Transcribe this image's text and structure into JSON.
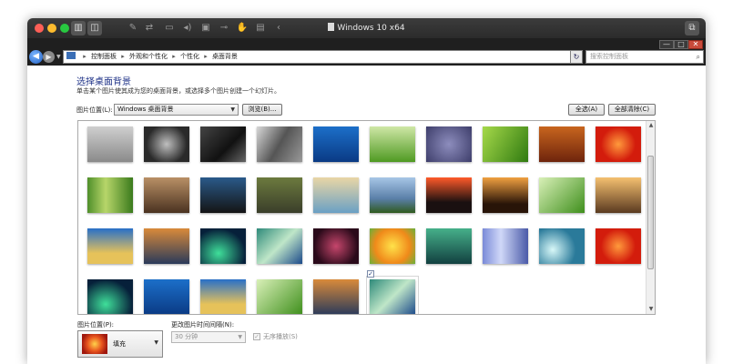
{
  "vm": {
    "title": "Windows 10 x64",
    "toolbar_icons": [
      "wrench-icon",
      "arrows-icon",
      "display-icon",
      "speaker-icon",
      "camera-icon",
      "usb-icon",
      "hand-icon",
      "shared-folder-icon",
      "chevron-left-icon"
    ]
  },
  "window": {
    "ctrl_min": "—",
    "ctrl_max": "□",
    "ctrl_close": "✕"
  },
  "address": {
    "breadcrumb": [
      "控制面板",
      "外观和个性化",
      "个性化",
      "桌面背景"
    ],
    "search_placeholder": "搜索控制面板"
  },
  "page": {
    "heading": "选择桌面背景",
    "subtext": "单击某个图片使其成为您的桌面背景，或选择多个图片创建一个幻灯片。",
    "location_label": "图片位置(L):",
    "location_value": "Windows 桌面背景",
    "browse_label": "浏览(B)...",
    "select_all_label": "全选(A)",
    "clear_all_label": "全部清除(C)"
  },
  "thumbnails": [
    {
      "bg": "linear-gradient(#cfcfcf,#8a8a8a)"
    },
    {
      "bg": "radial-gradient(circle at 50% 50%,#bfbfbf,#2a2a2a 70%)"
    },
    {
      "bg": "linear-gradient(135deg,#444,#111 60%,#666)"
    },
    {
      "bg": "linear-gradient(120deg,#d8d8d8,#555 50%,#999)"
    },
    {
      "bg": "linear-gradient(#1c6fc9,#0a3a84)"
    },
    {
      "bg": "linear-gradient(#cfe7a6,#4f9a22)"
    },
    {
      "bg": "radial-gradient(circle,#8d8dbd,#3d3d6a)"
    },
    {
      "bg": "linear-gradient(120deg,#a6d94a,#2f7a10)"
    },
    {
      "bg": "linear-gradient(#c8651e,#6e240c)"
    },
    {
      "bg": "radial-gradient(circle,#ff9a3c,#d31c0c 60%)"
    },
    {
      "bg": "linear-gradient(90deg,#4f8f2a,#b7d66a 40%,#3a7a1c)"
    },
    {
      "bg": "linear-gradient(#b99066,#4a3220)"
    },
    {
      "bg": "linear-gradient(#2a5a8a,#141414)"
    },
    {
      "bg": "linear-gradient(#6c7a3e,#3a3e2a)"
    },
    {
      "bg": "linear-gradient(#e9d6a5,#6aa0c4)"
    },
    {
      "bg": "linear-gradient(#a7c6e6,#5a7fa8 60%,#2f5a1e)"
    },
    {
      "bg": "linear-gradient(#ff5a2a,#1a1010 70%)"
    },
    {
      "bg": "linear-gradient(#f0a040,#281408 75%)"
    },
    {
      "bg": "linear-gradient(135deg,#d9f0b8,#3f8f1c)"
    },
    {
      "bg": "linear-gradient(#f5c070,#5a3a20)"
    },
    {
      "bg": "linear-gradient(#2870c8,#e6c25a 70%)"
    },
    {
      "bg": "linear-gradient(#d98a3a,#2a3a5a)"
    },
    {
      "bg": "radial-gradient(ellipse at 40% 70%,#3fdf9a,#06203a 70%)"
    },
    {
      "bg": "linear-gradient(135deg,#2e8a7a,#bfe6c8 50%,#1c4a8a)"
    },
    {
      "bg": "radial-gradient(circle,#c6466c,#2a0a1a 75%)"
    },
    {
      "bg": "radial-gradient(circle,#ffe24a,#f08a1a 60%,#6ab03a)"
    },
    {
      "bg": "linear-gradient(#46b08a,#124040)"
    },
    {
      "bg": "linear-gradient(90deg,#7a8ad8,#d0d8f8 40%,#4a5aa8)"
    },
    {
      "bg": "radial-gradient(circle at 30% 60%,#d8f8f8,#2a7a9a 60%)"
    },
    {
      "bg": "radial-gradient(circle,#ff9a3c,#d31c0c 60%)"
    },
    {
      "bg": "radial-gradient(ellipse at 40% 70%,#3fdf9a,#06203a 70%)"
    },
    {
      "bg": "linear-gradient(#1c6fc9,#0a3a84)"
    },
    {
      "bg": "linear-gradient(#2870c8,#e6c25a 70%)"
    },
    {
      "bg": "linear-gradient(135deg,#d9f0b8,#3f8f1c)"
    },
    {
      "bg": "linear-gradient(#d98a3a,#2a3a5a)"
    },
    {
      "bg": "linear-gradient(135deg,#2e8a7a,#bfe6c8 50%,#1c4a8a)",
      "checked": true
    }
  ],
  "bottom": {
    "position_label": "图片位置(P):",
    "position_value": "填充",
    "interval_label": "更改图片时间间隔(N):",
    "interval_value": "30 分钟",
    "shuffle_label": "无序播放(S)"
  }
}
